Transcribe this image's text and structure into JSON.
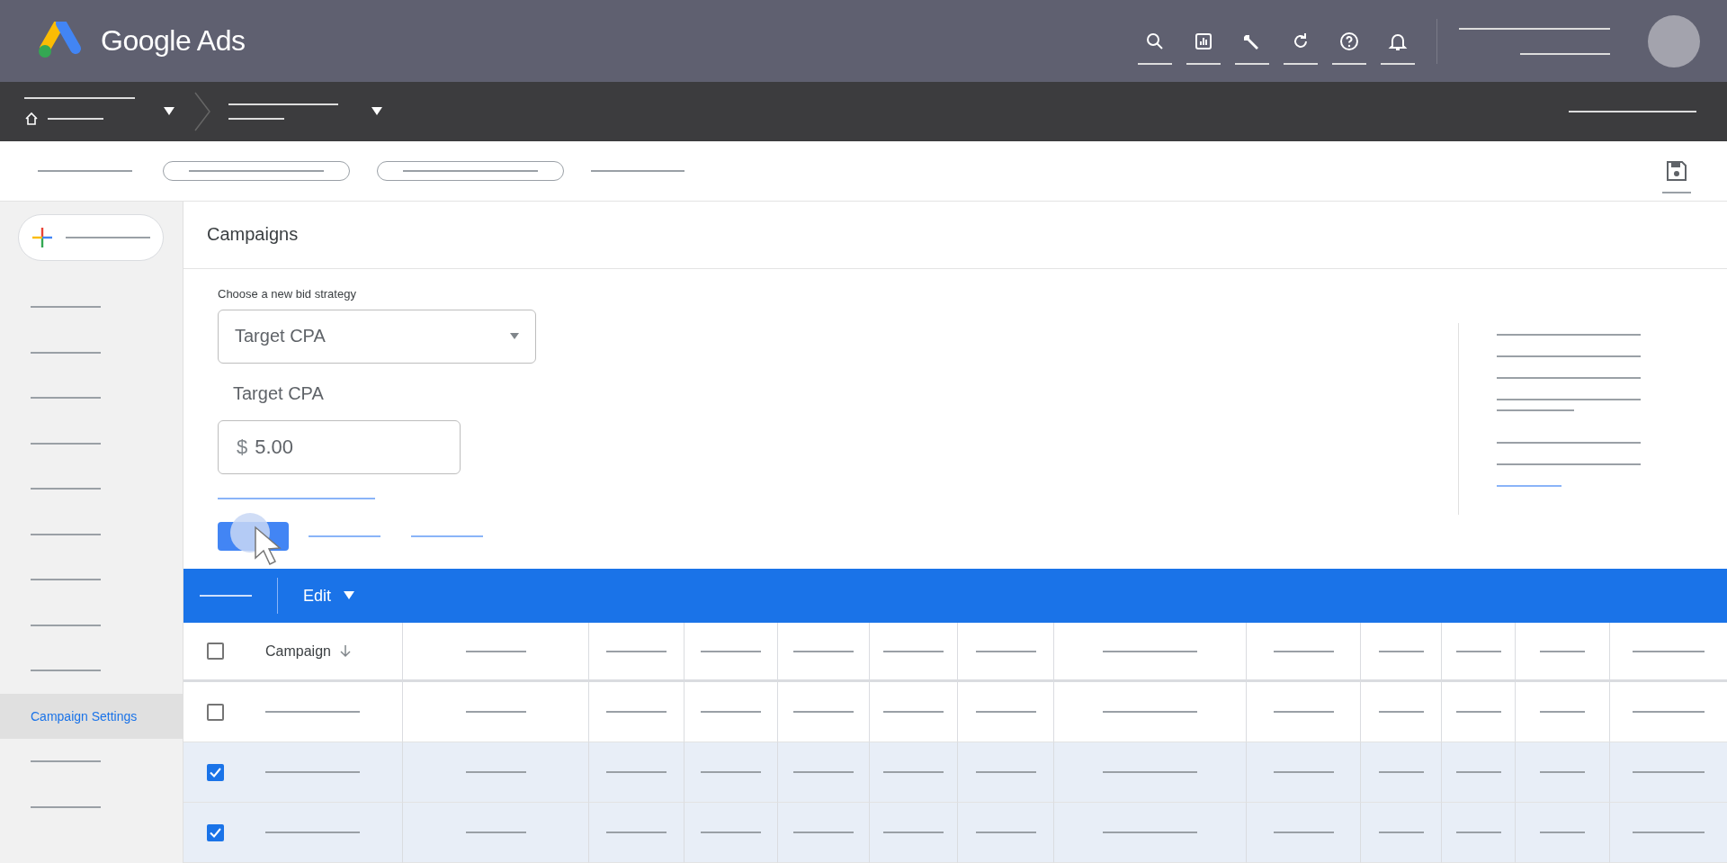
{
  "app": {
    "name": "Google Ads"
  },
  "sidebar": {
    "items": [
      {
        "selected": false
      },
      {
        "selected": false
      },
      {
        "selected": false
      },
      {
        "selected": false
      },
      {
        "selected": false
      },
      {
        "selected": false
      },
      {
        "selected": false
      },
      {
        "selected": false
      },
      {
        "selected": false
      },
      {
        "label": "Campaign Settings",
        "selected": true
      },
      {
        "selected": false
      },
      {
        "selected": false
      }
    ]
  },
  "page": {
    "title": "Campaigns"
  },
  "bid_form": {
    "strategy_label": "Choose a new bid strategy",
    "strategy_select": {
      "value": "Target CPA"
    },
    "target_label": "Target CPA",
    "target_input": {
      "prefix": "$",
      "value": "5.00"
    }
  },
  "table": {
    "edit_label": "Edit",
    "header_checked": false,
    "columns": [
      {
        "label": "Campaign"
      }
    ],
    "rows": [
      {
        "checked": false
      },
      {
        "checked": true
      },
      {
        "checked": true
      }
    ]
  }
}
